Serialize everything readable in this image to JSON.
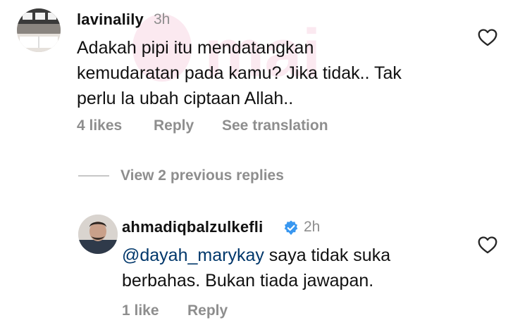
{
  "comment1": {
    "username": "lavinalily",
    "time": "3h",
    "text_line1": "Adakah pipi itu mendatangkan",
    "text_line2": "kemudaratan pada kamu? Jika tidak.. Tak",
    "text_line3": "perlu la ubah ciptaan Allah..",
    "likes": "4 likes",
    "reply": "Reply",
    "translate": "See translation"
  },
  "replies_toggle": {
    "label": "View 2 previous replies"
  },
  "comment2": {
    "username": "ahmadiqbalzulkefli",
    "time": "2h",
    "mention": "@dayah_marykay",
    "text_after_mention": " saya tidak suka",
    "text_line2": "berbahas. Bukan tiada jawapan.",
    "likes": "1 like",
    "reply": "Reply"
  },
  "icons": {
    "verified": "verified-badge-icon",
    "heart": "heart-outline-icon"
  },
  "colors": {
    "verified_blue": "#3897f0",
    "mention_blue": "#00376b",
    "meta_gray": "#8e8e8e"
  }
}
